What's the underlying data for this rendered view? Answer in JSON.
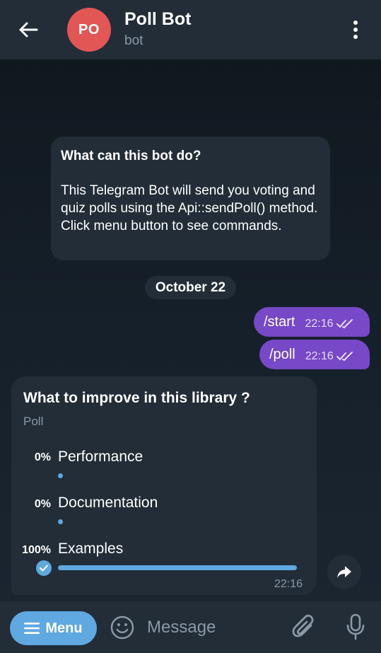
{
  "header": {
    "avatar_initials": "PO",
    "title": "Poll Bot",
    "subtitle": "bot",
    "avatar_color": "#e25656"
  },
  "info": {
    "heading": "What can this bot do?",
    "body": "This Telegram Bot will send you voting and quiz polls using the Api::sendPoll() method. Click menu button to see commands."
  },
  "date_label": "October 22",
  "messages": [
    {
      "text": "/start",
      "time": "22:16"
    },
    {
      "text": "/poll",
      "time": "22:16"
    }
  ],
  "poll": {
    "question": "What to improve in this library ?",
    "type": "Poll",
    "options": [
      {
        "percent": "0%",
        "label": "Performance",
        "fraction": 0
      },
      {
        "percent": "0%",
        "label": "Documentation",
        "fraction": 0
      },
      {
        "percent": "100%",
        "label": "Examples",
        "fraction": 1,
        "chosen": true
      }
    ],
    "time": "22:16"
  },
  "composer": {
    "menu_label": "Menu",
    "placeholder": "Message"
  },
  "colors": {
    "accent": "#5fa8e0",
    "outgoing": "#7748c7",
    "bubble": "#222d38"
  },
  "icons": [
    "back-arrow-icon",
    "more-vert-icon",
    "double-check-icon",
    "check-icon",
    "share-icon",
    "hamburger-icon",
    "emoji-icon",
    "paperclip-icon",
    "microphone-icon"
  ]
}
